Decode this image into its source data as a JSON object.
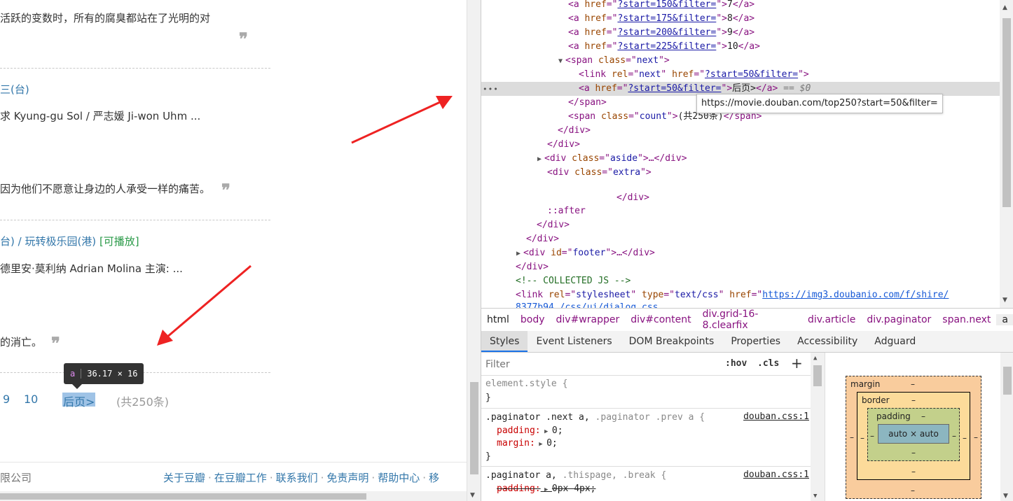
{
  "page": {
    "line1": "活跃的变数时，所有的腐臭都站在了光明的对",
    "q1": "❞",
    "title2": "三(台)",
    "actors2": "求 Kyung-gu Sol / 严志媛 Ji-won Uhm ...",
    "quote2": "因为他们不愿意让身边的人承受一样的痛苦。",
    "q2": "❞",
    "title3": "台) / 玩转极乐园(港)",
    "playable3": "[可播放]",
    "director3": "德里安·莫利纳 Adrian Molina   主演: ...",
    "quote3": "的消亡。",
    "q3": "❞",
    "tooltip_tag": "a",
    "tooltip_size": "36.17 × 16",
    "page9": "9",
    "page10": "10",
    "next": "后页>",
    "total": "(共250条)",
    "footer_company": "限公司",
    "footer_links": [
      "关于豆瓣",
      "在豆瓣工作",
      "联系我们",
      "免责声明",
      "帮助中心",
      "移"
    ]
  },
  "elements": {
    "a7": {
      "href": "?start=150&filter=",
      "text": "7"
    },
    "a8": {
      "href": "?start=175&filter=",
      "text": "8"
    },
    "a9": {
      "href": "?start=200&filter=",
      "text": "9"
    },
    "a10": {
      "href": "?start=225&filter=",
      "text": "10"
    },
    "span_next_class": "next",
    "link_rel": "next",
    "link_href": "?start=50&filter=",
    "a_next_href": "?start=50&filter=",
    "a_next_text": "后页>",
    "dollar": "== $0",
    "count_class": "count",
    "count_text": "(共250条)",
    "aside_class": "aside",
    "extra_class": "extra",
    "after": "::after",
    "footer_id": "footer",
    "comment": "<!-- COLLECTED JS -->",
    "stylesheet_href": "https://img3.doubanio.com/f/shire/",
    "stylesheet_href2": "8377b94 /css/ui/dialog.css",
    "url_tooltip": "https://movie.douban.com/top250?start=50&filter="
  },
  "breadcrumb": [
    "html",
    "body",
    "div#wrapper",
    "div#content",
    "div.grid-16-8.clearfix",
    "div.article",
    "div.paginator",
    "span.next",
    "a"
  ],
  "tabs": [
    "Styles",
    "Event Listeners",
    "DOM Breakpoints",
    "Properties",
    "Accessibility",
    "Adguard"
  ],
  "styles": {
    "filter_placeholder": "Filter",
    "hov": ":hov",
    "cls": ".cls",
    "plus": "+",
    "element_style": "element.style {",
    "close": "}",
    "rule1_sel_a": ".paginator .next a,",
    "rule1_sel_b": " .paginator .prev a {",
    "rule1_src": "douban.css:1",
    "rule1_p1": "padding:",
    "rule1_v1": "0;",
    "rule1_p2": "margin:",
    "rule1_v2": "0;",
    "rule2_sel_a": ".paginator a,",
    "rule2_sel_b": " .thispage, .break {",
    "rule2_src": "douban.css:1",
    "rule2_p1": "padding:",
    "rule2_v1": "0px 4px;"
  },
  "boxmodel": {
    "margin": "margin",
    "border": "border",
    "padding": "padding",
    "content": "auto × auto",
    "dash": "–"
  },
  "colors": {
    "link": "#3377aa",
    "arrow": "#ee2222",
    "selected_row": "#dcdcdc",
    "tag": "#881280",
    "attr_name": "#994500",
    "attr_value": "#1a1aa6"
  }
}
